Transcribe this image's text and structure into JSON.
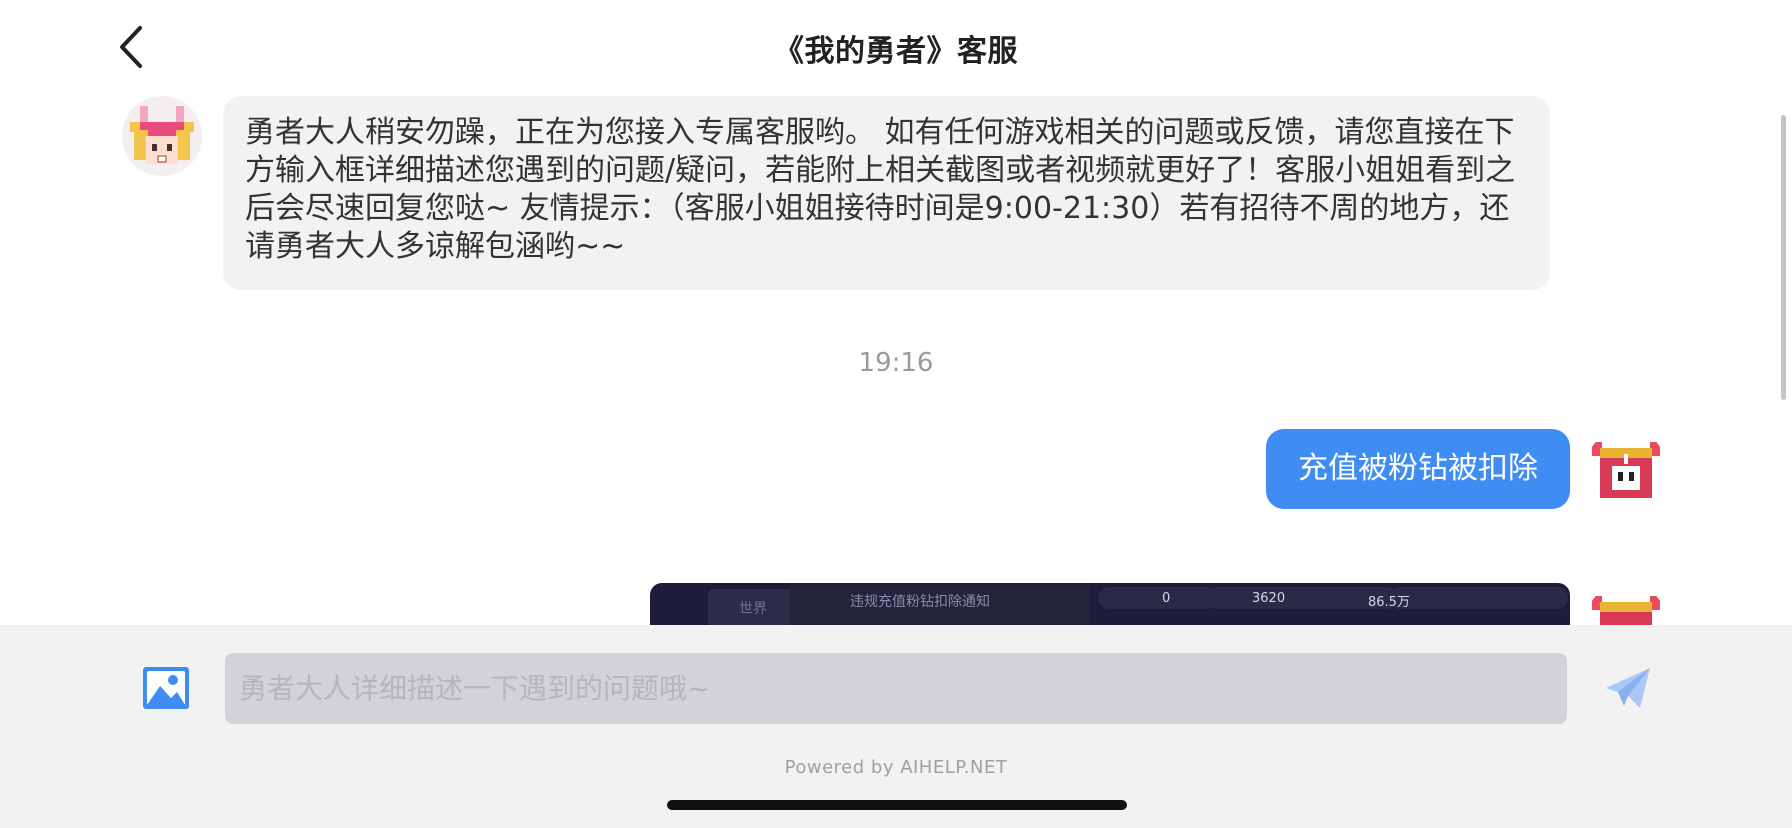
{
  "header": {
    "title": "《我的勇者》客服",
    "back_icon": "chevron-left-icon"
  },
  "messages": {
    "agent_text": "勇者大人稍安勿躁，正在为您接入专属客服哟。 如有任何游戏相关的问题或反馈，请您直接在下方输入框详细描述您遇到的问题/疑问，若能附上相关截图或者视频就更好了！客服小姐姐看到之后会尽速回复您哒~ 友情提示：（客服小姐姐接待时间是9:00-21:30）若有招待不周的地方，还请勇者大人多谅解包涵哟~~",
    "timestamp": "19:16",
    "user_text": "充值被粉钻被扣除",
    "screenshot_preview": {
      "tab": "世界",
      "notice": "违规充值粉钻扣除通知",
      "pink_diamonds": "0",
      "blue_diamonds": "3620",
      "gold": "86.5万"
    }
  },
  "composer": {
    "placeholder": "勇者大人详细描述一下遇到的问题哦~",
    "value": "",
    "image_icon": "image-icon",
    "send_icon": "send-icon"
  },
  "footer": {
    "powered": "Powered by AIHELP.NET"
  },
  "colors": {
    "accent": "#3f8cf3",
    "bubble_agent": "#f2f2f2",
    "bottom_bar": "#f2f2f2",
    "input_bg": "#d2d3d7"
  }
}
